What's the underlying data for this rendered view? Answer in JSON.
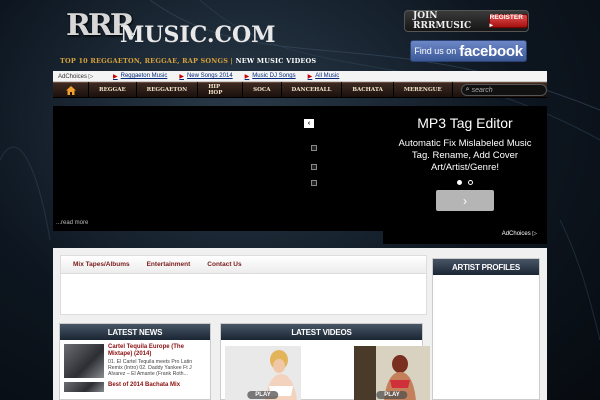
{
  "header": {
    "logo_rrr": "RRR",
    "logo_music": "MUSIC.COM",
    "tagline_main": "TOP 10 REGGAETON, REGGAE, RAP SONGS |",
    "tagline_new": "NEW MUSIC VIDEOS",
    "join_label": "JOIN RRRMUSIC",
    "register_label": "REGISTER ▸",
    "fb_find": "Find us on",
    "fb_brand": "facebook"
  },
  "linkbar": {
    "adchoices": "AdChoices ▷",
    "links": [
      "Reggaeton Music",
      "New Songs 2014",
      "Music DJ Songs",
      "All Music"
    ]
  },
  "nav": {
    "home_icon": "home-icon",
    "items": [
      "REGGAE",
      "REGGAETON",
      "HIP HOP",
      "SOCA",
      "DANCEHALL",
      "BACHATA",
      "MERENGUE"
    ],
    "search_placeholder": "search"
  },
  "slideshow": {
    "prev_glyph": "‹",
    "read_more": "...read more"
  },
  "ad": {
    "title": "MP3 Tag Editor",
    "description": "Automatic Fix Mislabeled Music Tag. Rename, Add Cover Art/Artist/Genre!",
    "next_glyph": "›",
    "adchoices": "AdChoices ▷"
  },
  "tabs": [
    "Mix Tapes/Albums",
    "Entertainment",
    "Contact Us"
  ],
  "artist_profiles": {
    "title": "ARTIST PROFILES"
  },
  "latest_news": {
    "title": "LATEST NEWS",
    "items": [
      {
        "title": "Cartel Tequila Europe (The Mixtape) (2014)",
        "summary": "01. El Cartel Tequila meets Pro Latin Remix (Intro) 02. Daddy Yankee Ft J Alvarez – El Amante (Frank Roth..."
      },
      {
        "title": "Best of 2014 Bachata Mix",
        "summary": ""
      }
    ]
  },
  "latest_videos": {
    "title": "LATEST VIDEOS",
    "play_label": "PLAY"
  },
  "colors": {
    "nav_text": "#f2e2c8",
    "tab_text": "#7a1a1a",
    "news_title": "#8a1010",
    "fb_blue": "#3b5998",
    "register_red": "#c0201f"
  }
}
